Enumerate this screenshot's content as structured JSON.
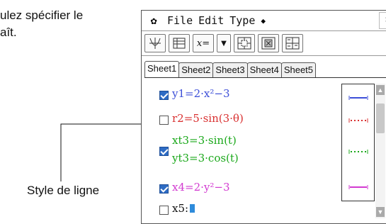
{
  "doc": {
    "line1": "ulez spécifier le",
    "line2": "aît.",
    "callout": "Style de ligne"
  },
  "menubar": {
    "gear_icon": "gear-icon",
    "items": [
      "File",
      "Edit",
      "Type"
    ],
    "dropdown_arrow": "◆",
    "close_label": "×"
  },
  "toolbar": {
    "graph_icon": "graph-axes-icon",
    "table_icon": "table-icon",
    "xeq_label": "x=",
    "dropdown_label": "▼",
    "zoom_icon": "zoom-box-icon",
    "zoom_fit_icon": "zoom-fit-icon",
    "table_settings_icon": "table-settings-icon"
  },
  "tabs": [
    "Sheet1",
    "Sheet2",
    "Sheet3",
    "Sheet4",
    "Sheet5"
  ],
  "functions": [
    {
      "checked": true,
      "text": "y1=2·x²−3",
      "color": "#3d4fd8"
    },
    {
      "checked": false,
      "text": "r2=5·sin(3·θ)",
      "color": "#d93030"
    },
    {
      "checked": true,
      "text": "xt3=3·sin(t)",
      "text2": "yt3=3·cos(t)",
      "color": "#1aa81a"
    },
    {
      "checked": true,
      "text": "x4=2·y²−3",
      "color": "#d23ad0"
    },
    {
      "checked": false,
      "text": "x5:",
      "color": "#111111"
    }
  ],
  "line_styles": [
    {
      "style": "solid",
      "color": "#3d4fd8"
    },
    {
      "style": "dotted",
      "color": "#d93030"
    },
    {
      "style": "dotted",
      "color": "#1aa81a"
    },
    {
      "style": "solid",
      "color": "#d23ad0"
    }
  ]
}
